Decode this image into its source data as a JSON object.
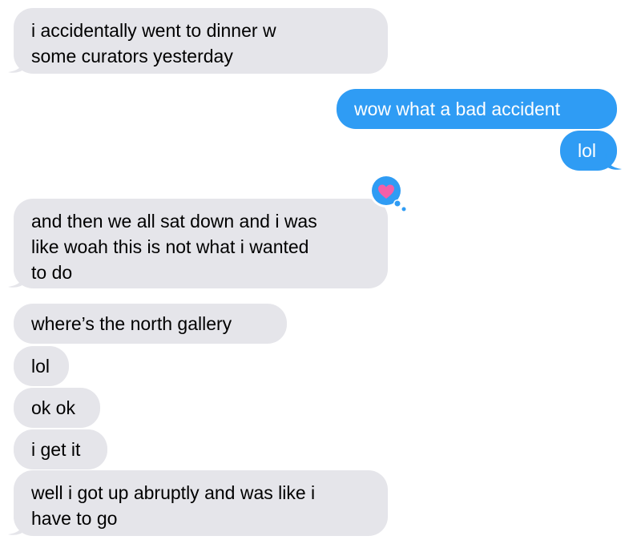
{
  "conversation": {
    "messages": [
      {
        "from": "them",
        "text": "i accidentally went to dinner w\nsome curators yesterday"
      },
      {
        "from": "me",
        "text": "wow what a bad accident"
      },
      {
        "from": "me",
        "text": "lol"
      },
      {
        "from": "them",
        "text": "and then we all sat down and i was\nlike woah this is not what i wanted\nto do",
        "tapback": "heart"
      },
      {
        "from": "them",
        "text": "where’s the north gallery"
      },
      {
        "from": "them",
        "text": "lol"
      },
      {
        "from": "them",
        "text": "ok ok"
      },
      {
        "from": "them",
        "text": "i get it"
      },
      {
        "from": "them",
        "text": "well i got up abruptly and was like i\nhave to go"
      }
    ]
  },
  "colors": {
    "received_bubble": "#e5e5ea",
    "sent_bubble": "#2f9cf4",
    "heart": "#f25fa8"
  }
}
